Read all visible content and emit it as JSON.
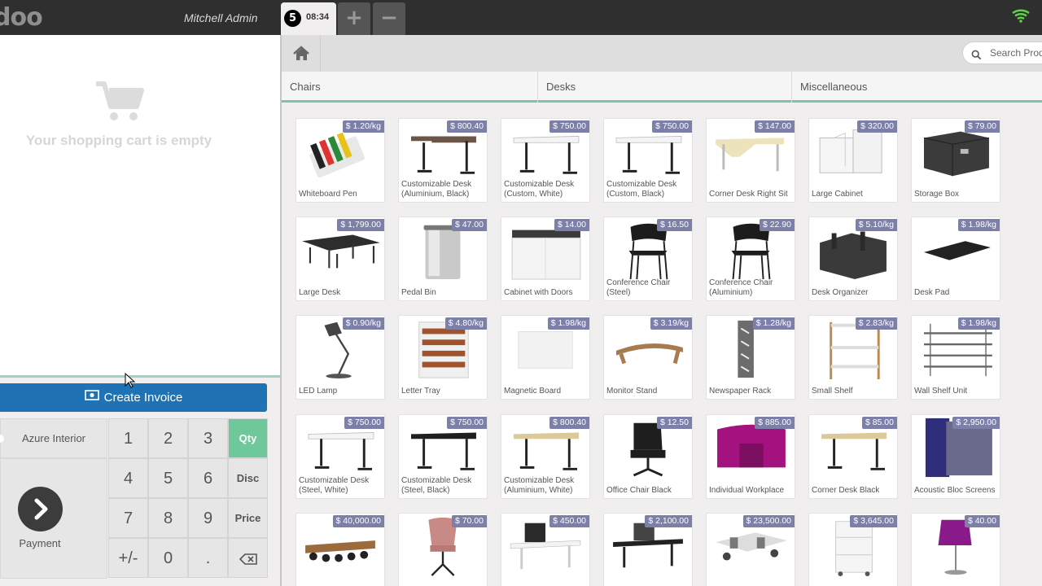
{
  "topbar": {
    "logo": "doo",
    "cashier": "Mitchell Admin",
    "order_number": "5",
    "order_time": "08:34",
    "add_label": "+",
    "remove_label": "−"
  },
  "order": {
    "empty_message": "Your shopping cart is empty"
  },
  "actions": {
    "create_invoice": "Create Invoice",
    "customer": "Azure Interior",
    "payment": "Payment"
  },
  "numpad": {
    "keys": [
      "1",
      "2",
      "3",
      "4",
      "5",
      "6",
      "7",
      "8",
      "9",
      "+/-",
      "0",
      "."
    ],
    "modes": [
      "Qty",
      "Disc",
      "Price"
    ],
    "active_mode": "Qty"
  },
  "search": {
    "placeholder": "Search Products"
  },
  "categories": [
    "Chairs",
    "Desks",
    "Miscellaneous"
  ],
  "products": [
    {
      "name": "Whiteboard Pen",
      "price": "$ 1.20/kg",
      "img": "pens"
    },
    {
      "name": "Customizable Desk (Aluminium, Black)",
      "price": "$ 800.40",
      "img": "desk-dark"
    },
    {
      "name": "Customizable Desk (Custom, White)",
      "price": "$ 750.00",
      "img": "desk-white"
    },
    {
      "name": "Customizable Desk (Custom, Black)",
      "price": "$ 750.00",
      "img": "desk-white"
    },
    {
      "name": "Corner Desk Right Sit",
      "price": "$ 147.00",
      "img": "desk-corner-wood"
    },
    {
      "name": "Large Cabinet",
      "price": "$ 320.00",
      "img": "cabinet-white"
    },
    {
      "name": "Storage Box",
      "price": "$ 79.00",
      "img": "box"
    },
    {
      "name": "Large Desk",
      "price": "$ 1,799.00",
      "img": "desk-large"
    },
    {
      "name": "Pedal Bin",
      "price": "$ 47.00",
      "img": "bin"
    },
    {
      "name": "Cabinet with Doors",
      "price": "$ 14.00",
      "img": "cabinet-doors"
    },
    {
      "name": "Conference Chair (Steel)",
      "price": "$ 16.50",
      "img": "chair"
    },
    {
      "name": "Conference Chair (Aluminium)",
      "price": "$ 22.90",
      "img": "chair"
    },
    {
      "name": "Desk Organizer",
      "price": "$ 5.10/kg",
      "img": "organizer"
    },
    {
      "name": "Desk Pad",
      "price": "$ 1.98/kg",
      "img": "pad"
    },
    {
      "name": "LED Lamp",
      "price": "$ 0.90/kg",
      "img": "lamp"
    },
    {
      "name": "Letter Tray",
      "price": "$ 4.80/kg",
      "img": "tray"
    },
    {
      "name": "Magnetic Board",
      "price": "$ 1.98/kg",
      "img": "board"
    },
    {
      "name": "Monitor Stand",
      "price": "$ 3.19/kg",
      "img": "stand"
    },
    {
      "name": "Newspaper Rack",
      "price": "$ 1.28/kg",
      "img": "rack"
    },
    {
      "name": "Small Shelf",
      "price": "$ 2.83/kg",
      "img": "shelf"
    },
    {
      "name": "Wall Shelf Unit",
      "price": "$ 1.98/kg",
      "img": "wallshelf"
    },
    {
      "name": "Customizable Desk (Steel, White)",
      "price": "$ 750.00",
      "img": "desk-white"
    },
    {
      "name": "Customizable Desk (Steel, Black)",
      "price": "$ 750.00",
      "img": "desk-black"
    },
    {
      "name": "Customizable Desk (Aluminium, White)",
      "price": "$ 800.40",
      "img": "desk-wood"
    },
    {
      "name": "Office Chair Black",
      "price": "$ 12.50",
      "img": "office-chair"
    },
    {
      "name": "Individual Workplace",
      "price": "$ 885.00",
      "img": "workplace"
    },
    {
      "name": "Corner Desk Black",
      "price": "$ 85.00",
      "img": "desk-wood"
    },
    {
      "name": "Acoustic Bloc Screens",
      "price": "$ 2,950.00",
      "img": "screens"
    },
    {
      "name": "",
      "price": "$ 40,000.00",
      "img": "conf-table"
    },
    {
      "name": "",
      "price": "$ 70.00",
      "img": "pink-chair"
    },
    {
      "name": "",
      "price": "$ 450.00",
      "img": "desk-screen"
    },
    {
      "name": "",
      "price": "$ 2,100.00",
      "img": "desk-screen-dark"
    },
    {
      "name": "",
      "price": "$ 23,500.00",
      "img": "open-space"
    },
    {
      "name": "",
      "price": "$ 3,645.00",
      "img": "drawer"
    },
    {
      "name": "",
      "price": "$ 40.00",
      "img": "purple-lamp"
    }
  ]
}
